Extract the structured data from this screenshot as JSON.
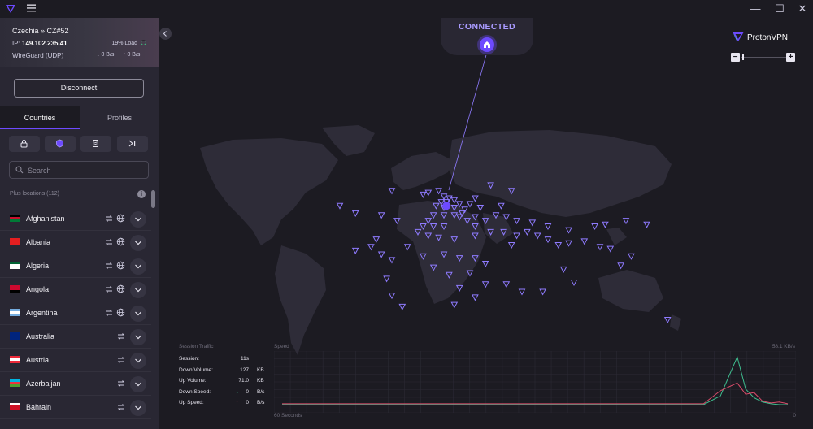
{
  "app": {
    "brand": "ProtonVPN"
  },
  "window_controls": {
    "minimize": "—",
    "maximize": "☐",
    "close": "✕"
  },
  "connection": {
    "server": "Czechia » CZ#52",
    "ip_label": "IP:",
    "ip": "149.102.235.41",
    "load": "19% Load",
    "load_fraction": 0.19,
    "protocol": "WireGuard (UDP)",
    "down_rate": "0 B/s",
    "up_rate": "0 B/s",
    "status": "CONNECTED",
    "disconnect_label": "Disconnect"
  },
  "tabs": [
    {
      "label": "Countries",
      "active": true
    },
    {
      "label": "Profiles",
      "active": false
    }
  ],
  "filters": [
    "lock-icon",
    "shield-icon",
    "secure-core-icon",
    "skip-icon"
  ],
  "search": {
    "placeholder": "Search"
  },
  "list": {
    "section_label": "Plus locations (112)",
    "countries": [
      {
        "name": "Afghanistan",
        "p2p": true,
        "tor": true,
        "flag": [
          "#000000",
          "#c8102e",
          "#007a36"
        ]
      },
      {
        "name": "Albania",
        "p2p": true,
        "tor": true,
        "flag": [
          "#e41e20",
          "#e41e20",
          "#e41e20"
        ]
      },
      {
        "name": "Algeria",
        "p2p": true,
        "tor": true,
        "flag": [
          "#006233",
          "#ffffff",
          "#ffffff"
        ]
      },
      {
        "name": "Angola",
        "p2p": true,
        "tor": true,
        "flag": [
          "#cc092f",
          "#cc092f",
          "#000000"
        ]
      },
      {
        "name": "Argentina",
        "p2p": true,
        "tor": true,
        "flag": [
          "#74acdf",
          "#ffffff",
          "#74acdf"
        ]
      },
      {
        "name": "Australia",
        "p2p": true,
        "tor": false,
        "flag": [
          "#00247d",
          "#00247d",
          "#00247d"
        ]
      },
      {
        "name": "Austria",
        "p2p": true,
        "tor": false,
        "flag": [
          "#ed2939",
          "#ffffff",
          "#ed2939"
        ]
      },
      {
        "name": "Azerbaijan",
        "p2p": true,
        "tor": false,
        "flag": [
          "#00b5e2",
          "#ef3340",
          "#509e2f"
        ]
      },
      {
        "name": "Bahrain",
        "p2p": true,
        "tor": false,
        "flag": [
          "#ffffff",
          "#ce1126",
          "#ce1126"
        ]
      }
    ]
  },
  "traffic": {
    "title": "Session Traffic",
    "rows": [
      {
        "label": "Session:",
        "value": "11s",
        "unit": "",
        "arrow": ""
      },
      {
        "label": "Down Volume:",
        "value": "127",
        "unit": "KB",
        "arrow": ""
      },
      {
        "label": "Up Volume:",
        "value": "71.0",
        "unit": "KB",
        "arrow": ""
      },
      {
        "label": "Down Speed:",
        "value": "0",
        "unit": "B/s",
        "arrow": "↓"
      },
      {
        "label": "Up Speed:",
        "value": "0",
        "unit": "B/s",
        "arrow": "↑"
      }
    ],
    "speed_label": "Speed",
    "speed_max": "58.1 KB/s",
    "x_start_label": "60 Seconds",
    "x_end_label": "0"
  },
  "chart_data": {
    "type": "line",
    "title": "",
    "xlabel": "",
    "ylabel": "Speed",
    "xlim": [
      60,
      0
    ],
    "ylim": [
      0,
      58.1
    ],
    "x": [
      60,
      55,
      50,
      45,
      40,
      35,
      30,
      25,
      20,
      15,
      10,
      8,
      6,
      5,
      4,
      3,
      2,
      1,
      0
    ],
    "series": [
      {
        "name": "",
        "color": "#3fbf90",
        "values": [
          0,
          0,
          0,
          0,
          0,
          0,
          0,
          0,
          0,
          0,
          0,
          10,
          55,
          18,
          8,
          3,
          1,
          0,
          0
        ]
      },
      {
        "name": "",
        "color": "#d94b6a",
        "values": [
          1,
          1,
          1,
          1,
          1,
          1,
          1,
          1,
          1,
          1,
          1,
          16,
          25,
          12,
          14,
          4,
          2,
          3,
          1
        ]
      }
    ]
  },
  "map_servers": [
    [
      0.4,
      0.36
    ],
    [
      0.46,
      0.38
    ],
    [
      0.47,
      0.37
    ],
    [
      0.49,
      0.36
    ],
    [
      0.5,
      0.39
    ],
    [
      0.505,
      0.42
    ],
    [
      0.51,
      0.4
    ],
    [
      0.52,
      0.41
    ],
    [
      0.495,
      0.42
    ],
    [
      0.485,
      0.44
    ],
    [
      0.5,
      0.45
    ],
    [
      0.52,
      0.45
    ],
    [
      0.53,
      0.43
    ],
    [
      0.54,
      0.46
    ],
    [
      0.55,
      0.43
    ],
    [
      0.56,
      0.4
    ],
    [
      0.535,
      0.48
    ],
    [
      0.52,
      0.49
    ],
    [
      0.5,
      0.49
    ],
    [
      0.48,
      0.49
    ],
    [
      0.47,
      0.52
    ],
    [
      0.46,
      0.55
    ],
    [
      0.48,
      0.55
    ],
    [
      0.5,
      0.55
    ],
    [
      0.53,
      0.5
    ],
    [
      0.545,
      0.52
    ],
    [
      0.56,
      0.5
    ],
    [
      0.58,
      0.52
    ],
    [
      0.6,
      0.49
    ],
    [
      0.62,
      0.5
    ],
    [
      0.64,
      0.52
    ],
    [
      0.67,
      0.53
    ],
    [
      0.7,
      0.55
    ],
    [
      0.74,
      0.57
    ],
    [
      0.79,
      0.55
    ],
    [
      0.81,
      0.54
    ],
    [
      0.85,
      0.52
    ],
    [
      0.89,
      0.54
    ],
    [
      0.3,
      0.44
    ],
    [
      0.33,
      0.48
    ],
    [
      0.38,
      0.49
    ],
    [
      0.41,
      0.52
    ],
    [
      0.45,
      0.58
    ],
    [
      0.47,
      0.6
    ],
    [
      0.49,
      0.61
    ],
    [
      0.52,
      0.62
    ],
    [
      0.56,
      0.6
    ],
    [
      0.59,
      0.58
    ],
    [
      0.615,
      0.58
    ],
    [
      0.64,
      0.6
    ],
    [
      0.66,
      0.58
    ],
    [
      0.68,
      0.6
    ],
    [
      0.7,
      0.62
    ],
    [
      0.72,
      0.65
    ],
    [
      0.74,
      0.64
    ],
    [
      0.77,
      0.63
    ],
    [
      0.8,
      0.66
    ],
    [
      0.82,
      0.67
    ],
    [
      0.86,
      0.71
    ],
    [
      0.84,
      0.76
    ],
    [
      0.5,
      0.7
    ],
    [
      0.53,
      0.72
    ],
    [
      0.56,
      0.72
    ],
    [
      0.58,
      0.75
    ],
    [
      0.55,
      0.8
    ],
    [
      0.58,
      0.86
    ],
    [
      0.62,
      0.86
    ],
    [
      0.65,
      0.9
    ],
    [
      0.56,
      0.93
    ],
    [
      0.53,
      0.88
    ],
    [
      0.38,
      0.7
    ],
    [
      0.43,
      0.66
    ],
    [
      0.46,
      0.71
    ],
    [
      0.4,
      0.73
    ],
    [
      0.48,
      0.77
    ],
    [
      0.51,
      0.81
    ],
    [
      0.52,
      0.97
    ],
    [
      0.4,
      0.92
    ],
    [
      0.42,
      0.98
    ],
    [
      0.39,
      0.83
    ],
    [
      0.93,
      1.05
    ],
    [
      0.73,
      0.78
    ],
    [
      0.69,
      0.9
    ],
    [
      0.75,
      0.85
    ],
    [
      0.59,
      0.33
    ],
    [
      0.63,
      0.36
    ],
    [
      0.61,
      0.44
    ],
    [
      0.57,
      0.45
    ],
    [
      0.56,
      0.55
    ],
    [
      0.63,
      0.65
    ],
    [
      0.33,
      0.68
    ],
    [
      0.37,
      0.62
    ],
    [
      0.36,
      0.66
    ]
  ]
}
